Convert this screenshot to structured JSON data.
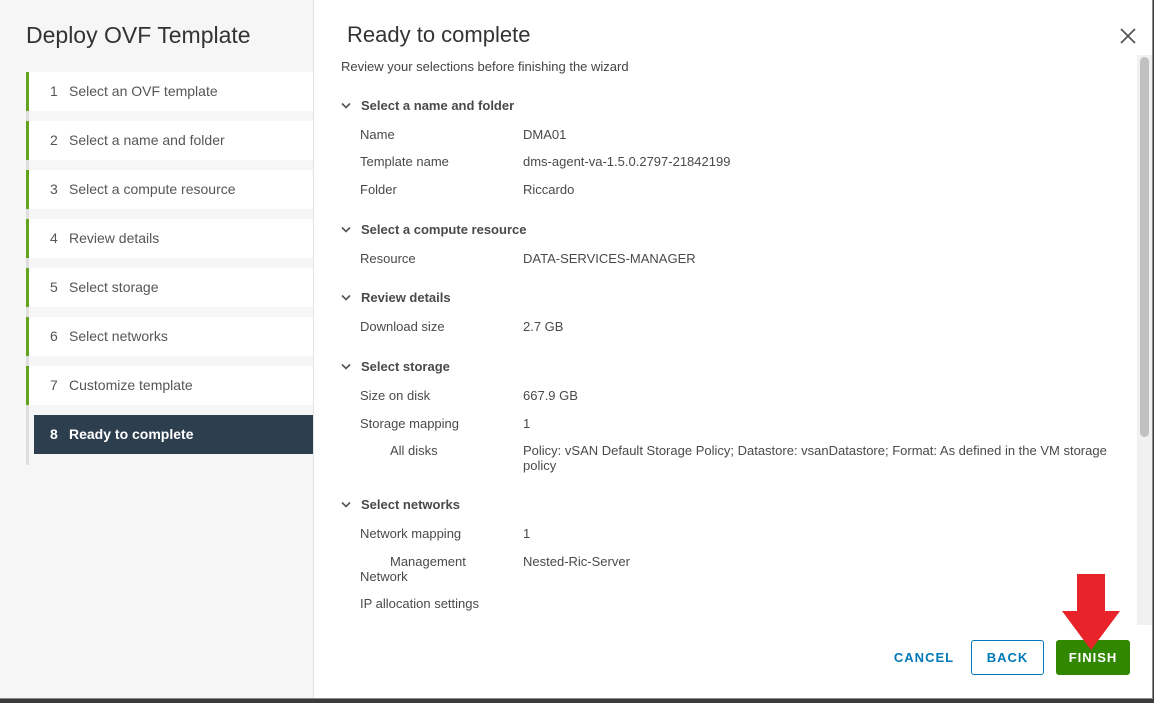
{
  "wizard": {
    "title": "Deploy OVF Template",
    "steps": [
      {
        "num": "1",
        "label": "Select an OVF template"
      },
      {
        "num": "2",
        "label": "Select a name and folder"
      },
      {
        "num": "3",
        "label": "Select a compute resource"
      },
      {
        "num": "4",
        "label": "Review details"
      },
      {
        "num": "5",
        "label": "Select storage"
      },
      {
        "num": "6",
        "label": "Select networks"
      },
      {
        "num": "7",
        "label": "Customize template"
      },
      {
        "num": "8",
        "label": "Ready to complete"
      }
    ],
    "active_step": 8
  },
  "main": {
    "title": "Ready to complete",
    "subtitle": "Review your selections before finishing the wizard",
    "sections": {
      "name_folder": {
        "heading": "Select a name and folder",
        "name_label": "Name",
        "name_value": "DMA01",
        "template_label": "Template name",
        "template_value": "dms-agent-va-1.5.0.2797-21842199",
        "folder_label": "Folder",
        "folder_value": "Riccardo"
      },
      "compute": {
        "heading": "Select a compute resource",
        "resource_label": "Resource",
        "resource_value": "DATA-SERVICES-MANAGER"
      },
      "review": {
        "heading": "Review details",
        "download_label": "Download size",
        "download_value": "2.7 GB"
      },
      "storage": {
        "heading": "Select storage",
        "size_label": "Size on disk",
        "size_value": "667.9 GB",
        "mapping_label": "Storage mapping",
        "mapping_value": "1",
        "disks_label": "All disks",
        "disks_value": "Policy: vSAN Default Storage Policy; Datastore: vsanDatastore; Format: As defined in the VM storage policy"
      },
      "networks": {
        "heading": "Select networks",
        "mapping_label": "Network mapping",
        "mapping_value": "1",
        "mgmt_label_1": "Management",
        "mgmt_label_2": "Network",
        "mgmt_value": "Nested-Ric-Server",
        "ip_label": "IP allocation settings"
      }
    }
  },
  "footer": {
    "cancel": "CANCEL",
    "back": "BACK",
    "finish": "FINISH"
  },
  "colors": {
    "accent_green": "#62a420",
    "finish_green": "#318700",
    "link_blue": "#0079b8",
    "active_step_bg": "#2d3f4f",
    "annotation_arrow": "#e8242a"
  },
  "icons": {
    "close": "close-icon",
    "chevron": "chevron-down-icon",
    "arrow": "arrow-down-annotation"
  }
}
